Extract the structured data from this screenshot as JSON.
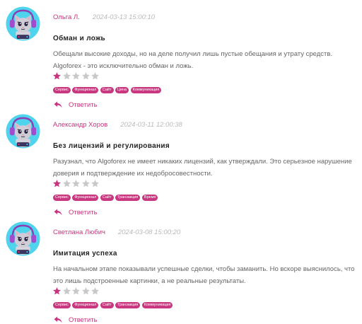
{
  "colors": {
    "accent": "#c8357e",
    "star_inactive": "#c8c8c8",
    "avatar_bg": "#4fd4ee"
  },
  "reviews": [
    {
      "author": "Ольга Л.",
      "date": "2024-03-13 15:00:10",
      "title": "Обман и ложь",
      "text": "Обещали высокие доходы, но на деле получил лишь пустые обещания и утрату средств. Algoforex - это исключительно обман и ложь.",
      "rating": 1,
      "rating_max": 5,
      "tags": [
        "Сервис",
        "Функционал",
        "Сайт",
        "Цена",
        "Коммуникация"
      ],
      "reply_label": "Ответить"
    },
    {
      "author": "Александр Хоров",
      "date": "2024-03-11 12:00:38",
      "title": "Без лицензий и регулирования",
      "text": "Разузнал, что Algoforex не имеет никаких лицензий, как утверждали. Это серьезное нарушение доверия и подтверждение их недобросовестности.",
      "rating": 1,
      "rating_max": 5,
      "tags": [
        "Сервис",
        "Функционал",
        "Сайт",
        "Транзакция",
        "Время"
      ],
      "reply_label": "Ответить"
    },
    {
      "author": "Светлана Любич",
      "date": "2024-03-08 15:00:20",
      "title": "Имитация успеха",
      "text": "На начальном этапе показывали успешные сделки, чтобы заманить. Но вскоре выяснилось, что это лишь подстроенные картинки, а не реальные результаты.",
      "rating": 1,
      "rating_max": 5,
      "tags": [
        "Сервис",
        "Функционал",
        "Сайт",
        "Транзакция",
        "Коммуникация"
      ],
      "reply_label": "Ответить"
    }
  ]
}
